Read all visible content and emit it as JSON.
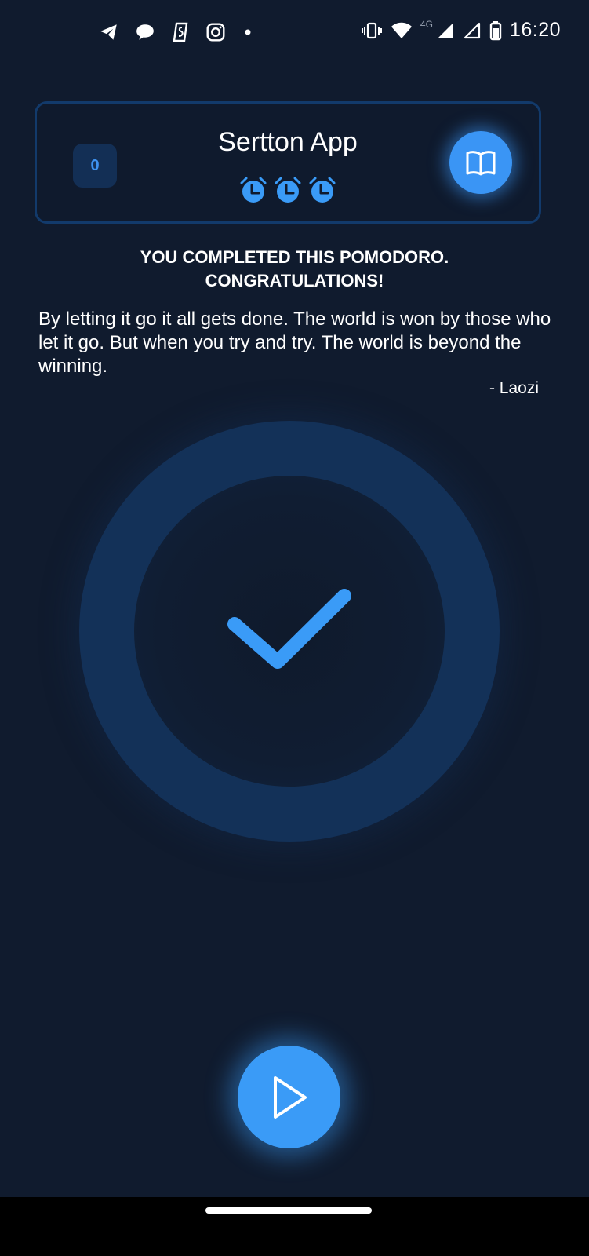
{
  "status_bar": {
    "time": "16:20",
    "network_label": "4G",
    "icons_left": [
      "telegram-icon",
      "chat-bubble-icon",
      "shazam-icon",
      "instagram-icon",
      "notification-dot-icon"
    ],
    "icons_right": [
      "vibrate-icon",
      "wifi-icon",
      "signal-icon",
      "signal-empty-icon",
      "battery-icon"
    ]
  },
  "header": {
    "counter": "0",
    "title": "Sertton App",
    "alarm_count": 3,
    "book_button_icon": "open-book-icon"
  },
  "message": {
    "congrats_line1": "YOU COMPLETED THIS POMODORO.",
    "congrats_line2": "CONGRATULATIONS!",
    "quote": "By letting it go it all gets done. The world is won by those who let it go. But when you try and try. The world is beyond the winning.",
    "author": "- Laozi"
  },
  "center": {
    "icon": "checkmark-icon"
  },
  "controls": {
    "play_icon": "play-icon"
  },
  "colors": {
    "background": "#101b2e",
    "accent": "#3a9bf7",
    "ring": "#133158",
    "card_border": "#123a6b"
  }
}
